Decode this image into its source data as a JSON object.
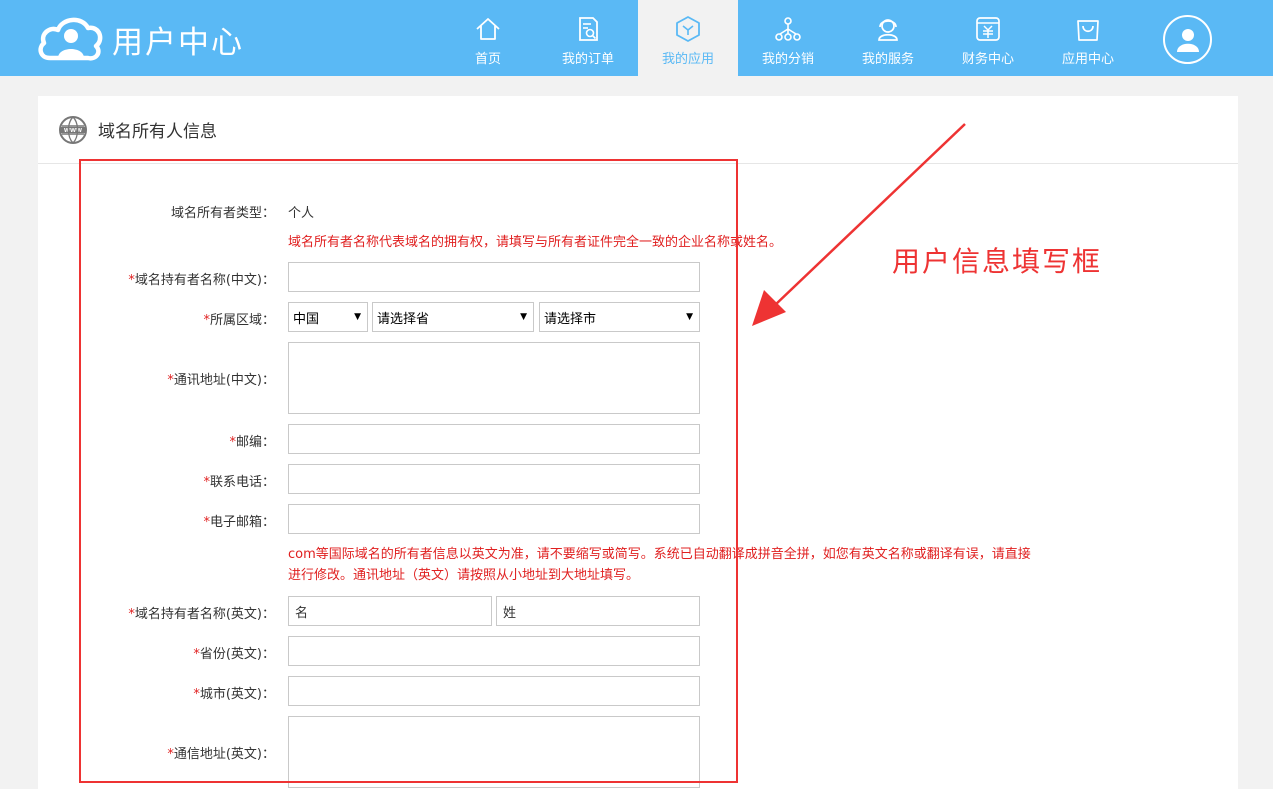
{
  "header": {
    "brand_title": "用户中心",
    "nav": [
      {
        "label": "首页",
        "icon": "home-icon",
        "active": false
      },
      {
        "label": "我的订单",
        "icon": "order-icon",
        "active": false
      },
      {
        "label": "我的应用",
        "icon": "app-cube-icon",
        "active": true
      },
      {
        "label": "我的分销",
        "icon": "distribution-icon",
        "active": false
      },
      {
        "label": "我的服务",
        "icon": "service-icon",
        "active": false
      },
      {
        "label": "财务中心",
        "icon": "finance-icon",
        "active": false
      },
      {
        "label": "应用中心",
        "icon": "shopping-bag-icon",
        "active": false
      }
    ],
    "colors": {
      "header_bg": "#5ab9f5",
      "active_text": "#5ab9f5"
    }
  },
  "panel": {
    "title": "域名所有人信息",
    "icon": "www-globe-icon"
  },
  "form": {
    "owner_type_label": "域名所有者类型：",
    "owner_type_value": "个人",
    "note_cn": "域名所有者名称代表域名的拥有权，请填写与所有者证件完全一致的企业名称或姓名。",
    "name_cn_label": "域名持有者名称(中文)：",
    "region_label": "所属区域：",
    "region_country": "中国",
    "region_province": "请选择省",
    "region_city": "请选择市",
    "address_cn_label": "通讯地址(中文)：",
    "postcode_label": "邮编：",
    "phone_label": "联系电话：",
    "email_label": "电子邮箱：",
    "note_en_line1": "com等国际域名的所有者信息以英文为准，请不要缩写或简写。系统已自动翻译成拼音全拼，如您有英文名称或翻译有误，请直接",
    "note_en_line2": "进行修改。通讯地址（英文）请按照从小地址到大地址填写。",
    "name_en_label": "域名持有者名称(英文)：",
    "name_en_first": "名",
    "name_en_last": "姓",
    "province_en_label": "省份(英文)：",
    "city_en_label": "城市(英文)：",
    "address_en_label": "通信地址(英文)：",
    "required_mark": "*"
  },
  "annotation": {
    "text": "用户信息填写框",
    "color": "#ee3333"
  }
}
